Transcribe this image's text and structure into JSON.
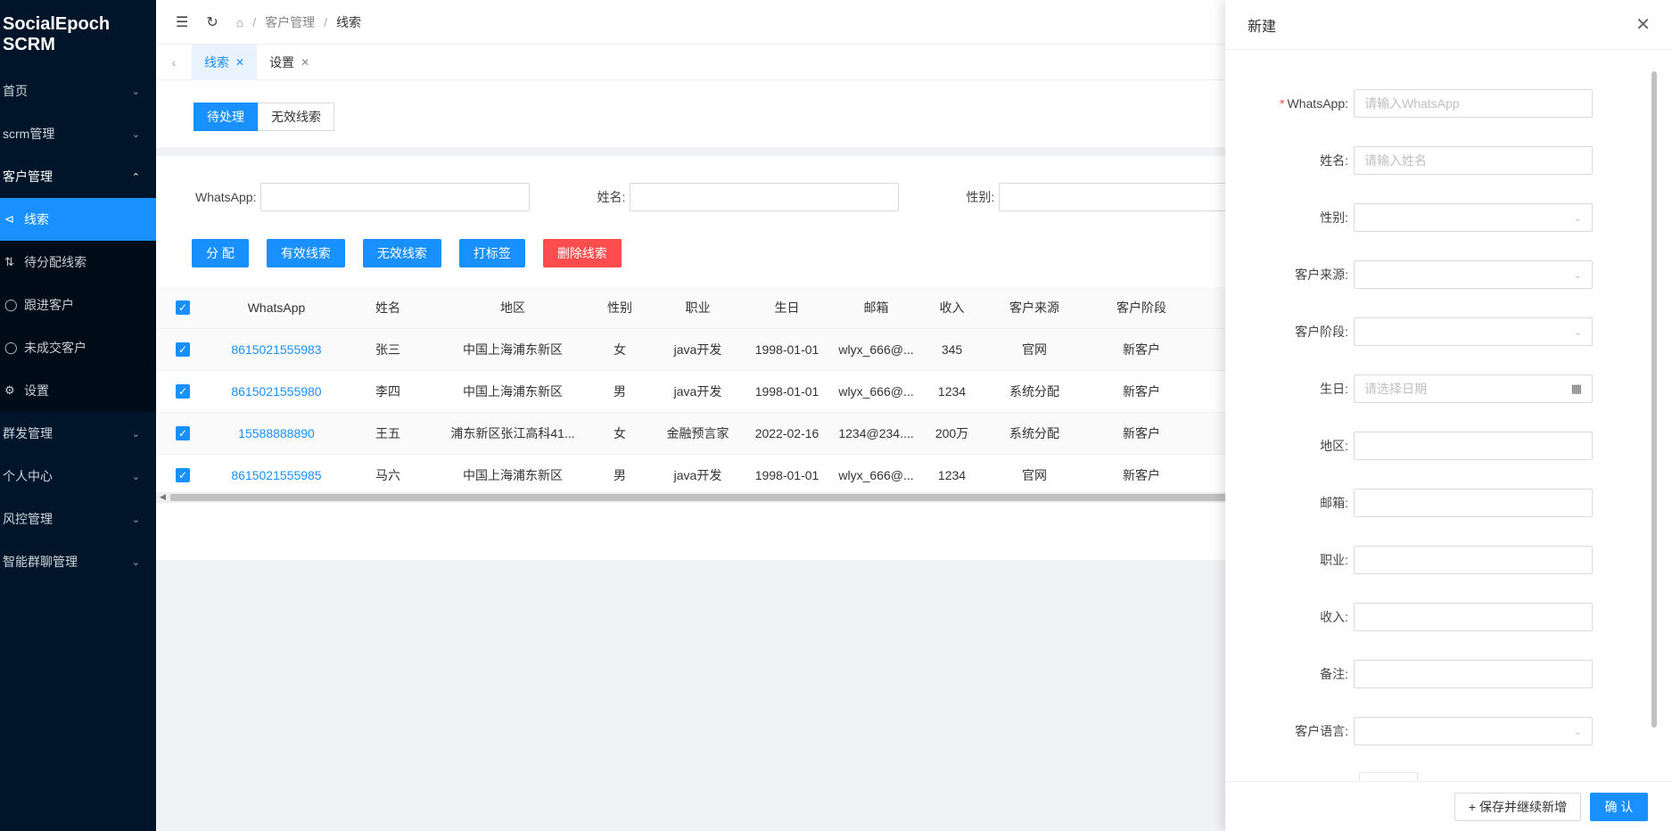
{
  "app": {
    "title": "SocialEpoch SCRM"
  },
  "sidebar": {
    "groups_before": [
      {
        "label": "首页"
      },
      {
        "label": "scrm管理"
      }
    ],
    "open_group": {
      "label": "客户管理"
    },
    "sub_items": [
      {
        "label": "线索",
        "icon": "share-icon"
      },
      {
        "label": "待分配线索",
        "icon": "branch-icon"
      },
      {
        "label": "跟进客户",
        "icon": "user-icon"
      },
      {
        "label": "未成交客户",
        "icon": "user-icon"
      },
      {
        "label": "设置",
        "icon": "gear-icon"
      }
    ],
    "groups_after": [
      {
        "label": "群发管理"
      },
      {
        "label": "个人中心"
      },
      {
        "label": "风控管理"
      },
      {
        "label": "智能群聊管理"
      }
    ]
  },
  "breadcrumb": {
    "sep": "/",
    "parent": "客户管理",
    "current": "线索"
  },
  "tabs": [
    {
      "label": "线索"
    },
    {
      "label": "设置"
    }
  ],
  "segments": [
    {
      "label": "待处理"
    },
    {
      "label": "无效线索"
    }
  ],
  "filters": [
    {
      "label": "WhatsApp:"
    },
    {
      "label": "姓名:"
    },
    {
      "label": "性别:"
    }
  ],
  "actions": [
    {
      "label": "分 配"
    },
    {
      "label": "有效线索"
    },
    {
      "label": "无效线索"
    },
    {
      "label": "打标签"
    },
    {
      "label": "删除线索"
    }
  ],
  "table": {
    "headers": [
      "WhatsApp",
      "姓名",
      "地区",
      "性别",
      "职业",
      "生日",
      "邮箱",
      "收入",
      "客户来源",
      "客户阶段"
    ],
    "rows": [
      [
        "8615021555983",
        "张三",
        "中国上海浦东新区",
        "女",
        "java开发",
        "1998-01-01",
        "wlyx_666@...",
        "345",
        "官网",
        "新客户"
      ],
      [
        "8615021555980",
        "李四",
        "中国上海浦东新区",
        "男",
        "java开发",
        "1998-01-01",
        "wlyx_666@...",
        "1234",
        "系统分配",
        "新客户"
      ],
      [
        "15588888890",
        "王五",
        "浦东新区张江高科41...",
        "女",
        "金融预言家",
        "2022-02-16",
        "1234@234....",
        "200万",
        "系统分配",
        "新客户"
      ],
      [
        "8615021555985",
        "马六",
        "中国上海浦东新区",
        "男",
        "java开发",
        "1998-01-01",
        "wlyx_666@...",
        "1234",
        "官网",
        "新客户"
      ]
    ]
  },
  "drawer": {
    "title": "新建",
    "fields": [
      {
        "label": "WhatsApp:",
        "placeholder": "请输入WhatsApp",
        "required": "*"
      },
      {
        "label": "姓名:",
        "placeholder": "请输入姓名"
      },
      {
        "label": "性别:",
        "placeholder": ""
      },
      {
        "label": "客户来源:",
        "placeholder": ""
      },
      {
        "label": "客户阶段:",
        "placeholder": ""
      },
      {
        "label": "生日:",
        "placeholder": "请选择日期"
      },
      {
        "label": "地区:",
        "placeholder": ""
      },
      {
        "label": "邮箱:",
        "placeholder": ""
      },
      {
        "label": "职业:",
        "placeholder": ""
      },
      {
        "label": "收入:",
        "placeholder": ""
      },
      {
        "label": "备注:",
        "placeholder": ""
      },
      {
        "label": "客户语言:",
        "placeholder": ""
      }
    ],
    "save_continue": "+ 保存并继续新增",
    "confirm": "确 认"
  },
  "colors": {
    "primary": "#1890ff",
    "danger": "#ff4d4f",
    "sidebar": "#001529"
  }
}
